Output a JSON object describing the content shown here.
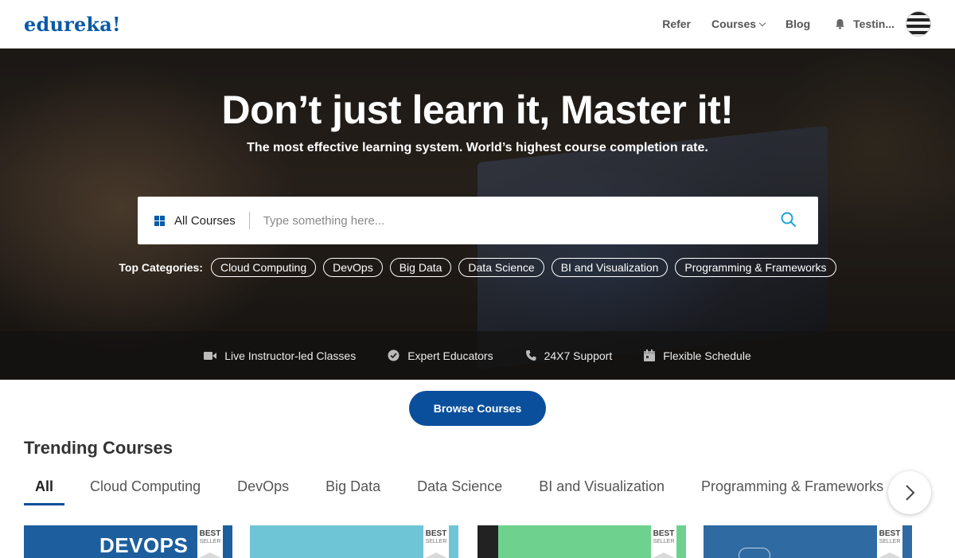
{
  "header": {
    "logo": "edureka!",
    "nav": {
      "refer": "Refer",
      "courses": "Courses",
      "blog": "Blog",
      "user": "Testin..."
    }
  },
  "hero": {
    "title": "Don’t just learn it, Master it!",
    "subtitle": "The most effective learning system. World’s highest course completion rate.",
    "search": {
      "category": "All Courses",
      "placeholder": "Type something here..."
    },
    "top_categories_label": "Top Categories:",
    "top_categories": [
      "Cloud Computing",
      "DevOps",
      "Big Data",
      "Data Science",
      "BI and Visualization",
      "Programming & Frameworks"
    ],
    "features": [
      {
        "icon": "video-camera-icon",
        "label": "Live Instructor-led Classes"
      },
      {
        "icon": "check-circle-icon",
        "label": "Expert Educators"
      },
      {
        "icon": "phone-icon",
        "label": "24X7 Support"
      },
      {
        "icon": "calendar-icon",
        "label": "Flexible Schedule"
      }
    ]
  },
  "browse_button": "Browse Courses",
  "trending": {
    "title": "Trending Courses",
    "tabs": [
      "All",
      "Cloud Computing",
      "DevOps",
      "Big Data",
      "Data Science",
      "BI and Visualization",
      "Programming & Frameworks"
    ],
    "active_tab": "All",
    "cards": [
      {
        "text": "DEVOPS",
        "badge_top": "BEST",
        "badge_bottom": "SELLER",
        "color": "#1d5f9e"
      },
      {
        "text": "",
        "badge_top": "BEST",
        "badge_bottom": "SELLER",
        "color": "#6ec5d6"
      },
      {
        "text": "",
        "badge_top": "BEST",
        "badge_bottom": "SELLER",
        "color": "#6fd18e"
      },
      {
        "text": "",
        "badge_top": "BEST",
        "badge_bottom": "SELLER",
        "color": "#2f6aa3"
      }
    ]
  },
  "colors": {
    "brand": "#0a5aa5",
    "button": "#0a4f9c",
    "search_icon": "#1aa3d9"
  }
}
